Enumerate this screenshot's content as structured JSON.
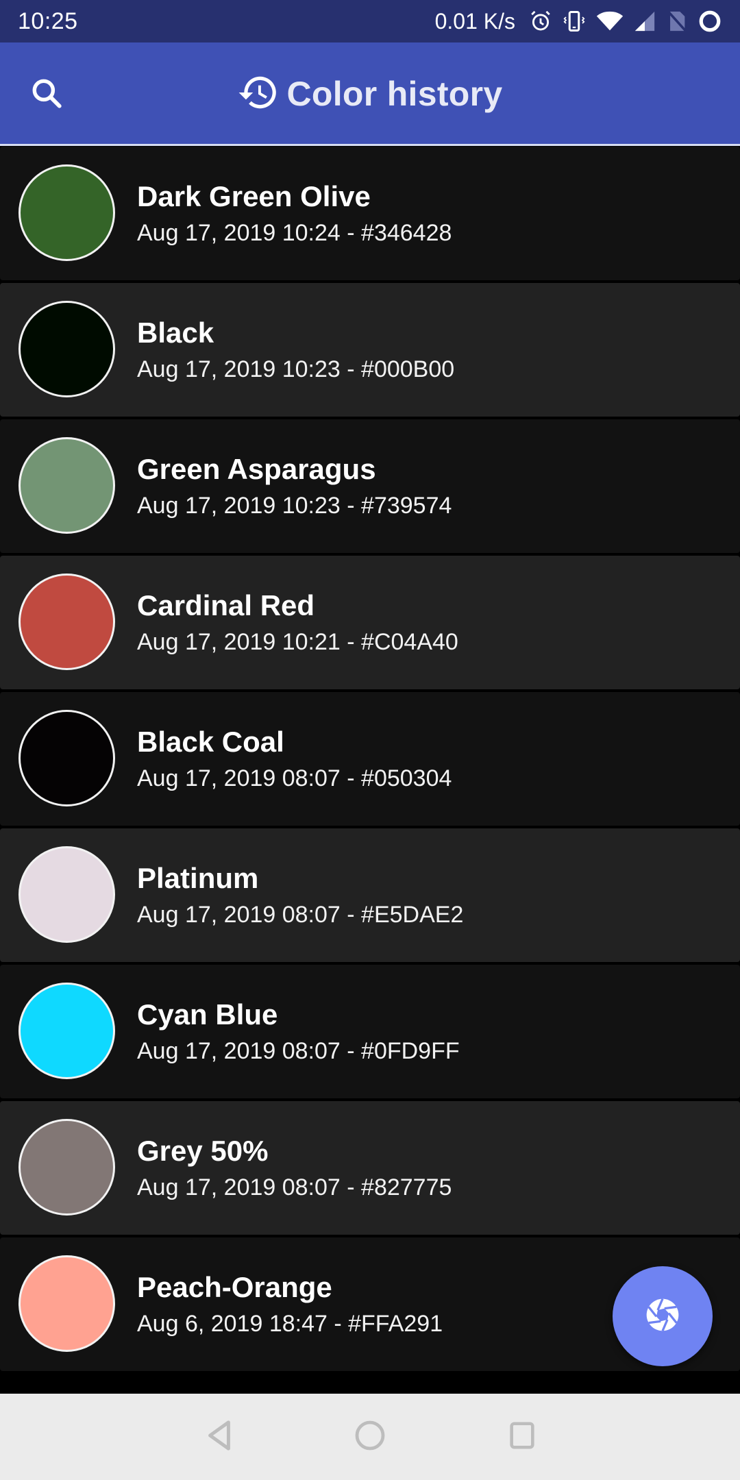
{
  "status_bar": {
    "time": "10:25",
    "network_speed": "0.01 K/s",
    "icons": [
      "alarm-icon",
      "vibrate-icon",
      "wifi-icon",
      "signal-icon",
      "no-sim-icon",
      "battery-icon"
    ]
  },
  "app_bar": {
    "title": "Color history",
    "title_icon": "history-icon",
    "search_icon": "search-icon"
  },
  "colors": {
    "accent": "#3F51B5",
    "status_bar": "#27306F",
    "fab": "#6F83F2",
    "row_odd": "#121212",
    "row_even": "#222222"
  },
  "history": [
    {
      "name": "Dark Green Olive",
      "date": "Aug 17, 2019 10:24",
      "hex": "#346428",
      "meta": "Aug 17, 2019 10:24 - #346428"
    },
    {
      "name": "Black",
      "date": "Aug 17, 2019 10:23",
      "hex": "#000B00",
      "meta": "Aug 17, 2019 10:23 - #000B00"
    },
    {
      "name": "Green Asparagus",
      "date": "Aug 17, 2019 10:23",
      "hex": "#739574",
      "meta": "Aug 17, 2019 10:23 - #739574"
    },
    {
      "name": "Cardinal Red",
      "date": "Aug 17, 2019 10:21",
      "hex": "#C04A40",
      "meta": "Aug 17, 2019 10:21 - #C04A40"
    },
    {
      "name": "Black Coal",
      "date": "Aug 17, 2019 08:07",
      "hex": "#050304",
      "meta": "Aug 17, 2019 08:07 - #050304"
    },
    {
      "name": "Platinum",
      "date": "Aug 17, 2019 08:07",
      "hex": "#E5DAE2",
      "meta": "Aug 17, 2019 08:07 - #E5DAE2"
    },
    {
      "name": "Cyan Blue",
      "date": "Aug 17, 2019 08:07",
      "hex": "#0FD9FF",
      "meta": "Aug 17, 2019 08:07 - #0FD9FF"
    },
    {
      "name": "Grey 50%",
      "date": "Aug 17, 2019 08:07",
      "hex": "#827775",
      "meta": "Aug 17, 2019 08:07 - #827775"
    },
    {
      "name": "Peach-Orange",
      "date": "Aug 6, 2019 18:47",
      "hex": "#FFA291",
      "meta": "Aug 6, 2019 18:47 - #FFA291"
    }
  ],
  "fab": {
    "icon": "camera-aperture-icon"
  },
  "nav_bar": {
    "buttons": [
      "back",
      "home",
      "recents"
    ]
  }
}
